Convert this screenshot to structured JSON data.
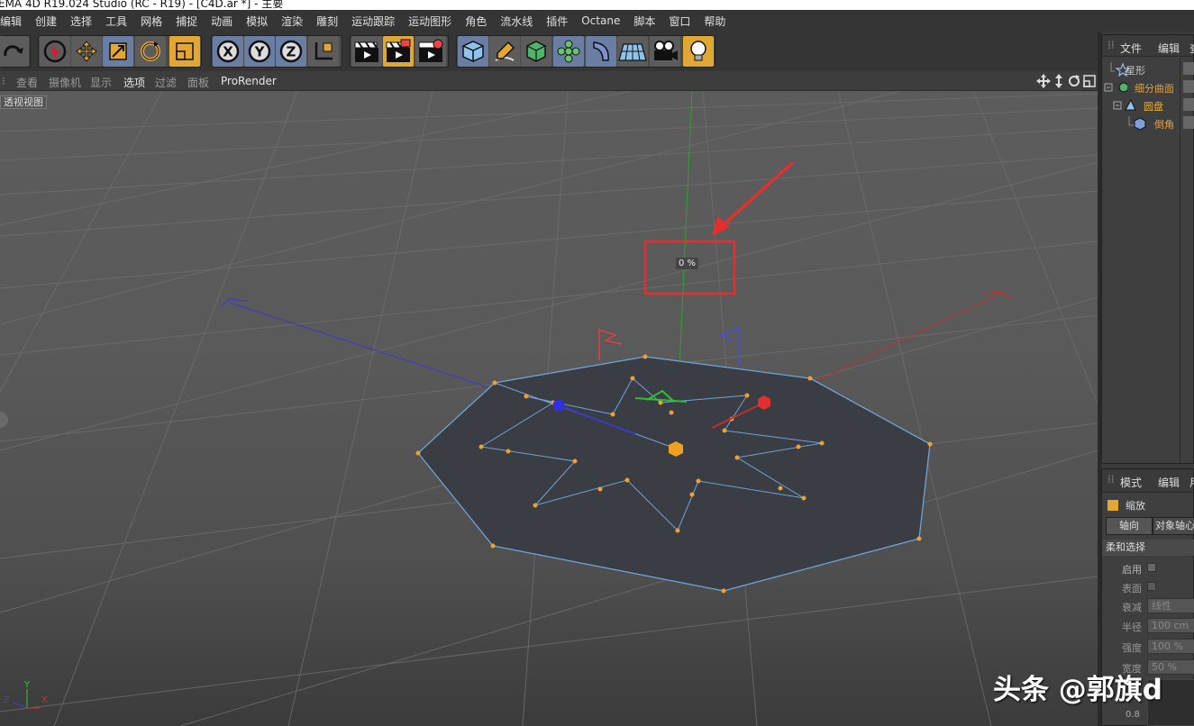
{
  "window_title": "EMA 4D R19.024 Studio (RC - R19) - [C4D.ar *] - 主要",
  "menu": [
    "编辑",
    "创建",
    "选择",
    "工具",
    "网格",
    "捕捉",
    "动画",
    "模拟",
    "渲染",
    "雕刻",
    "运动跟踪",
    "运动图形",
    "角色",
    "流水线",
    "插件",
    "Octane",
    "脚本",
    "窗口",
    "帮助"
  ],
  "toolbar": {
    "axis_x": "X",
    "axis_y": "Y",
    "axis_z": "Z"
  },
  "viewport_menu": [
    "查看",
    "摄像机",
    "显示",
    "选项",
    "过滤",
    "面板",
    "ProRender"
  ],
  "viewport": {
    "label": "透视视图",
    "scale_readout": "0 %",
    "axis_y": "Y",
    "axis_z": "Z",
    "axis_x": "X"
  },
  "object_manager": {
    "tabs": [
      "文件",
      "编辑",
      "查"
    ],
    "objects": [
      {
        "name": "星形",
        "color": "#c8c8c8"
      },
      {
        "name": "细分曲面",
        "color": "#e2a03a"
      },
      {
        "name": "圆盘",
        "color": "#e6b23a"
      },
      {
        "name": "倒角",
        "color": "#e6a23a"
      }
    ]
  },
  "attribute_manager": {
    "tabs": [
      "模式",
      "编辑",
      "用"
    ],
    "tool_name": "缩放",
    "sub_tabs": [
      "轴向",
      "对象轴心"
    ],
    "section": "柔和选择",
    "fields": [
      {
        "label": "启用",
        "value": ""
      },
      {
        "label": "表面",
        "value": ""
      },
      {
        "label": "衰减",
        "value": "线性"
      },
      {
        "label": "半径",
        "value": "100 cm"
      },
      {
        "label": "强度",
        "value": "100 %"
      },
      {
        "label": "宽度",
        "value": "50 %"
      }
    ],
    "graph_value": "0.8"
  },
  "watermark": "头条 @郭旗d"
}
